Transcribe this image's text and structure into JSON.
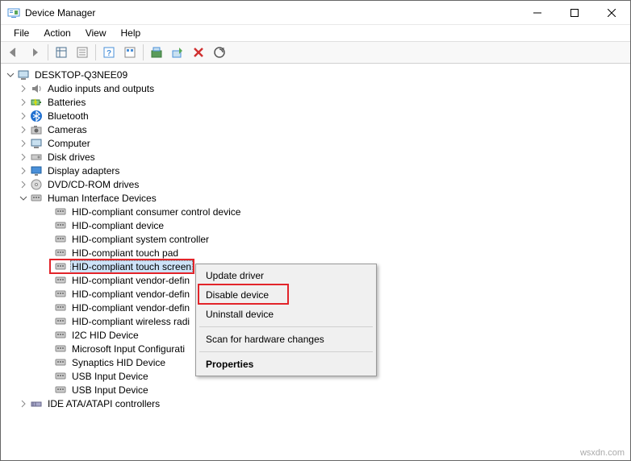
{
  "window": {
    "title": "Device Manager"
  },
  "menubar": [
    "File",
    "Action",
    "View",
    "Help"
  ],
  "tree": {
    "root": "DESKTOP-Q3NEE09",
    "categories": [
      {
        "label": "Audio inputs and outputs",
        "icon": "audio",
        "expanded": false
      },
      {
        "label": "Batteries",
        "icon": "battery",
        "expanded": false
      },
      {
        "label": "Bluetooth",
        "icon": "bluetooth",
        "expanded": false
      },
      {
        "label": "Cameras",
        "icon": "camera",
        "expanded": false
      },
      {
        "label": "Computer",
        "icon": "computer",
        "expanded": false
      },
      {
        "label": "Disk drives",
        "icon": "disk",
        "expanded": false
      },
      {
        "label": "Display adapters",
        "icon": "display",
        "expanded": false
      },
      {
        "label": "DVD/CD-ROM drives",
        "icon": "dvd",
        "expanded": false
      },
      {
        "label": "Human Interface Devices",
        "icon": "hid",
        "expanded": true,
        "children": [
          "HID-compliant consumer control device",
          "HID-compliant device",
          "HID-compliant system controller",
          "HID-compliant touch pad",
          "HID-compliant touch screen",
          "HID-compliant vendor-defin",
          "HID-compliant vendor-defin",
          "HID-compliant vendor-defin",
          "HID-compliant wireless radi",
          "I2C HID Device",
          "Microsoft Input Configurati",
          "Synaptics HID Device",
          "USB Input Device",
          "USB Input Device"
        ],
        "selected_index": 4
      },
      {
        "label": "IDE ATA/ATAPI controllers",
        "icon": "ide",
        "expanded": false,
        "partial": true
      }
    ]
  },
  "context_menu": {
    "items": [
      {
        "label": "Update driver",
        "type": "item"
      },
      {
        "label": "Disable device",
        "type": "item",
        "highlight": true
      },
      {
        "label": "Uninstall device",
        "type": "item"
      },
      {
        "type": "sep"
      },
      {
        "label": "Scan for hardware changes",
        "type": "item"
      },
      {
        "type": "sep"
      },
      {
        "label": "Properties",
        "type": "item",
        "bold": true
      }
    ]
  },
  "watermark": "wsxdn.com"
}
